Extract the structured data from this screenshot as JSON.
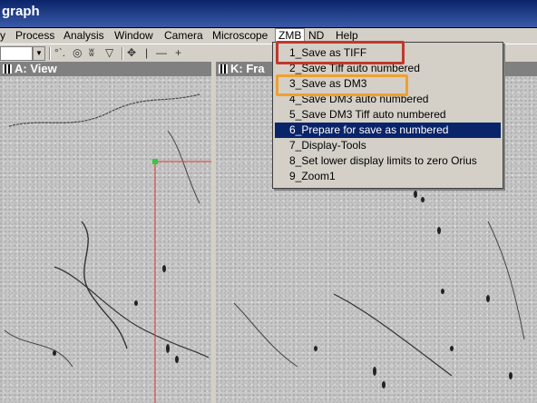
{
  "title": "graph",
  "menus": [
    {
      "id": "view",
      "label": "y"
    },
    {
      "id": "process",
      "label": "Process"
    },
    {
      "id": "analysis",
      "label": "Analysis"
    },
    {
      "id": "window",
      "label": "Window"
    },
    {
      "id": "camera",
      "label": "Camera"
    },
    {
      "id": "microscope",
      "label": "Microscope"
    },
    {
      "id": "zmb",
      "label": "ZMB"
    },
    {
      "id": "nd",
      "label": "ND"
    },
    {
      "id": "help",
      "label": "Help"
    }
  ],
  "toolbar": {
    "icons": [
      "dots-tool-icon",
      "circle-tool-icon",
      "pattern-tool-icon",
      "triangle-tool-icon",
      "move-tool-icon",
      "vertical-line-icon",
      "horizontal-line-icon",
      "plus-icon"
    ],
    "glyphs": [
      "°`.",
      "◎",
      "ʬ",
      "▽",
      "✥",
      "|",
      "—",
      "+"
    ]
  },
  "panes": [
    {
      "id": "a",
      "title": "A: View"
    },
    {
      "id": "k",
      "title": "K: Fra"
    }
  ],
  "zmb_menu": {
    "items": [
      {
        "label": "1_Save as TIFF",
        "selected": false
      },
      {
        "label": "2_Save Tiff auto numbered",
        "selected": false
      },
      {
        "label": "3_Save as DM3",
        "selected": false
      },
      {
        "label": "4_Save DM3 auto numbered",
        "selected": false
      },
      {
        "label": "5_Save DM3 Tiff auto numbered",
        "selected": false
      },
      {
        "label": "6_Prepare for save as numbered",
        "selected": true
      },
      {
        "label": "7_Display-Tools",
        "selected": false
      },
      {
        "label": "8_Set lower display limits to zero Orius",
        "selected": false
      },
      {
        "label": "9_Zoom1",
        "selected": false
      }
    ]
  },
  "colors": {
    "highlight_red": "#c0392b",
    "highlight_orange": "#f0a030",
    "selection": "#0a246a"
  }
}
